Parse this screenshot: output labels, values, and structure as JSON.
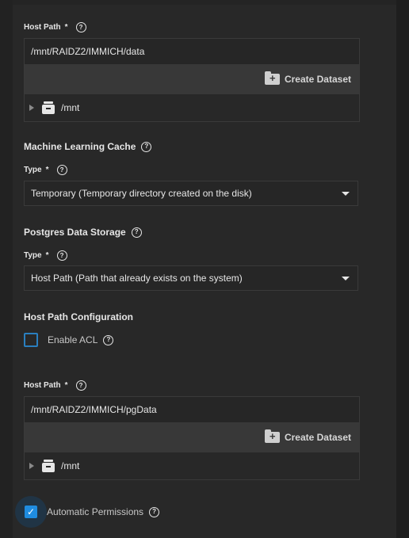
{
  "hostpath1": {
    "label": "Host Path",
    "required": "*",
    "value": "/mnt/RAIDZ2/IMMICH/data",
    "create_label": "Create Dataset",
    "tree_node": "/mnt"
  },
  "ml_cache": {
    "title": "Machine Learning Cache",
    "type_label": "Type",
    "required": "*",
    "selected": "Temporary (Temporary directory created on the disk)"
  },
  "pg_storage": {
    "title": "Postgres Data Storage",
    "type_label": "Type",
    "required": "*",
    "selected": "Host Path (Path that already exists on the system)"
  },
  "hostpath_config": {
    "title": "Host Path Configuration",
    "enable_acl_label": "Enable ACL"
  },
  "hostpath2": {
    "label": "Host Path",
    "required": "*",
    "value": "/mnt/RAIDZ2/IMMICH/pgData",
    "create_label": "Create Dataset",
    "tree_node": "/mnt"
  },
  "auto_perms": {
    "label": "Automatic Permissions",
    "checked": true
  },
  "icons": {
    "help": "help-circle-icon",
    "folder_plus": "folder-plus-icon",
    "drive": "drive-icon",
    "caret": "caret-down-icon",
    "tree_expand": "tree-expand-arrow-icon"
  },
  "colors": {
    "background": "#282828",
    "accent": "#1f8ce0",
    "toolbar": "#383838"
  }
}
